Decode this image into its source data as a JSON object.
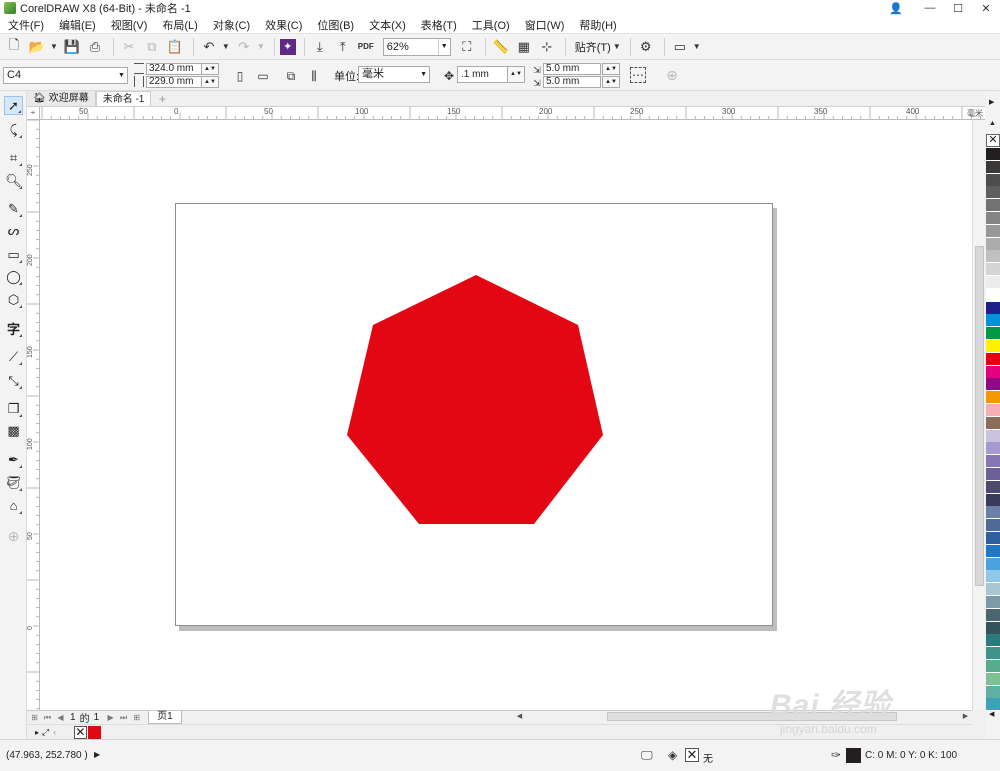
{
  "window": {
    "title": "CorelDRAW X8 (64-Bit) - 未命名 -1",
    "controls": [
      "—",
      "☐",
      "✕"
    ]
  },
  "menu": [
    "文件(F)",
    "编辑(E)",
    "视图(V)",
    "布局(L)",
    "对象(C)",
    "效果(C)",
    "位图(B)",
    "文本(X)",
    "表格(T)",
    "工具(O)",
    "窗口(W)",
    "帮助(H)"
  ],
  "toolbar": {
    "zoom": "62%",
    "snap_label": "贴齐(T)",
    "pdf_label": "PDF"
  },
  "propbar": {
    "page_preset": "C4",
    "width": "324.0 mm",
    "height": "229.0 mm",
    "unit_label": "单位:",
    "unit_value": "毫米",
    "nudge": ".1 mm",
    "dup_x": "5.0 mm",
    "dup_y": "5.0 mm"
  },
  "tabs": {
    "welcome": "欢迎屏幕",
    "document": "未命名 -1"
  },
  "ruler": {
    "h_labels": [
      "50",
      "0",
      "50",
      "100",
      "150",
      "200",
      "250",
      "300",
      "350",
      "400"
    ],
    "v_labels": [
      "250",
      "200",
      "150",
      "100",
      "50",
      "0"
    ],
    "unit": "毫米"
  },
  "shape": {
    "name": "heptagon",
    "fill": "#e30613"
  },
  "pagenav": {
    "current": "1",
    "of": "的",
    "total": "1",
    "page_tab": "页1"
  },
  "status": {
    "coords": "(47.963, 252.780 )",
    "fill_label": "无",
    "outline_cmyk": "C: 0 M: 0 Y: 0 K: 100"
  },
  "palette_colors": [
    "#231f20",
    "#3b3838",
    "#4d4d4d",
    "#5f5f5f",
    "#727272",
    "#858585",
    "#989898",
    "#acacac",
    "#c0c0c0",
    "#d4d4d4",
    "#ececec",
    "#ffffff",
    "#1d2088",
    "#0092d8",
    "#009944",
    "#fff100",
    "#e60012",
    "#e4007f",
    "#920783",
    "#f39800",
    "#f6aeb7",
    "#8c6d5a",
    "#c9c3e0",
    "#a69ad0",
    "#8776b4",
    "#6d5f98",
    "#4e4a6e",
    "#3a3a5c",
    "#6c7fa8",
    "#4f6a97",
    "#2f5f9d",
    "#1f78c6",
    "#4aa3df",
    "#8fc8ea",
    "#a9c6d4",
    "#7c9aa8",
    "#4b6670",
    "#33525a",
    "#2c7a7b",
    "#3d9488",
    "#58ab8d",
    "#7fbf94",
    "#5fb0a3",
    "#3fa1b8"
  ],
  "watermark": {
    "main": "Bai 经验",
    "sub": "jingyan.baidu.com"
  }
}
